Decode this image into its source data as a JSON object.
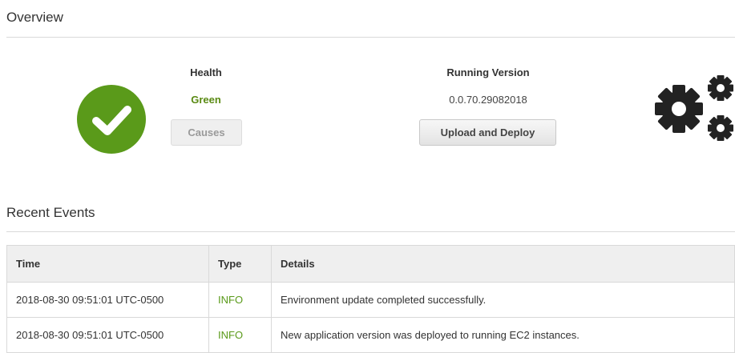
{
  "overview": {
    "title": "Overview",
    "health": {
      "label": "Health",
      "value": "Green",
      "causes_button": "Causes",
      "status_icon": "check-circle-icon",
      "status_color": "#5a9a1a"
    },
    "version": {
      "label": "Running Version",
      "value": "0.0.70.29082018",
      "deploy_button": "Upload and Deploy"
    },
    "config_icon": "gears-icon"
  },
  "events": {
    "title": "Recent Events",
    "columns": [
      "Time",
      "Type",
      "Details"
    ],
    "rows": [
      {
        "time": "2018-08-30 09:51:01 UTC-0500",
        "type": "INFO",
        "details": "Environment update completed successfully."
      },
      {
        "time": "2018-08-30 09:51:01 UTC-0500",
        "type": "INFO",
        "details": "New application version was deployed to running EC2 instances."
      }
    ]
  }
}
